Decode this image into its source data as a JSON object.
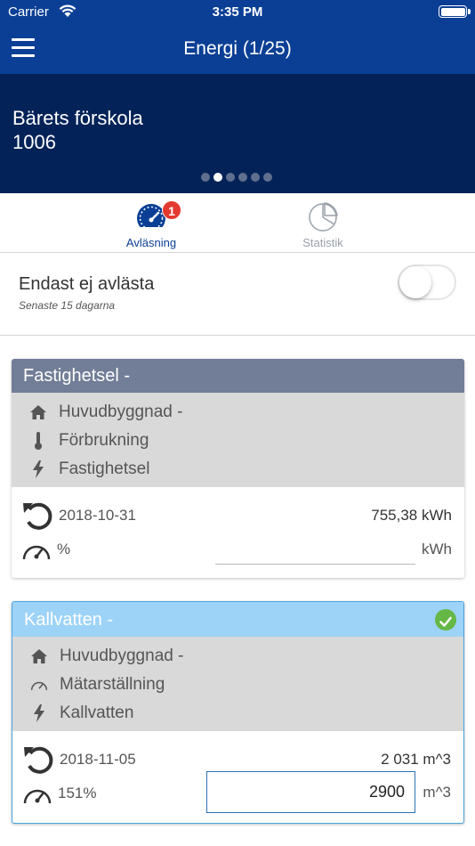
{
  "status_bar": {
    "carrier": "Carrier",
    "time": "3:35 PM"
  },
  "nav": {
    "title": "Energi (1/25)"
  },
  "hero": {
    "name_line1": "Bärets förskola",
    "name_line2": "1006",
    "pages": 6,
    "active_page": 1
  },
  "tabs": [
    {
      "label": "Avläsning",
      "badge": "1",
      "icon": "speedometer-icon",
      "active": true
    },
    {
      "label": "Statistik",
      "icon": "pie-chart-icon",
      "active": false
    }
  ],
  "filter": {
    "title": "Endast ej avlästa",
    "subtitle": "Senaste 15 dagarna",
    "enabled": false
  },
  "meters": [
    {
      "title": "Fastighetsel -",
      "building": "Huvudbyggnad -",
      "type": "Förbrukning",
      "category": "Fastighetsel",
      "last_date": "2018-10-31",
      "last_value": "755,38 kWh",
      "percent": "%",
      "input_value": "",
      "unit": "kWh",
      "done": false
    },
    {
      "title": "Kallvatten -",
      "building": "Huvudbyggnad -",
      "type": "Mätarställning",
      "category": "Kallvatten",
      "last_date": "2018-11-05",
      "last_value": "2 031 m^3",
      "percent": "151%",
      "input_value": "2900",
      "unit": "m^3",
      "done": true
    }
  ],
  "colors": {
    "nav": "#0b3f95",
    "hero": "#032358",
    "badge": "#e33a2f",
    "check": "#65b845"
  }
}
